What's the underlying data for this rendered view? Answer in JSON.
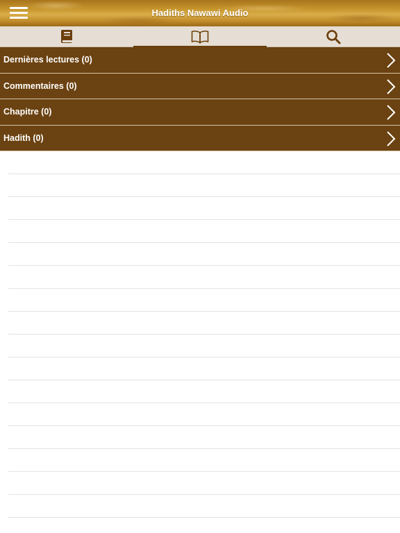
{
  "header": {
    "title": "Hadiths Nawawi Audio",
    "menu_icon": "hamburger-menu-icon"
  },
  "tabs": [
    {
      "icon": "book-icon",
      "active": false
    },
    {
      "icon": "open-book-icon",
      "active": true
    },
    {
      "icon": "search-icon",
      "active": false
    }
  ],
  "menu": {
    "items": [
      {
        "label": "Dernières lectures (0)"
      },
      {
        "label": "Commentaires (0)"
      },
      {
        "label": "Chapitre (0)"
      },
      {
        "label": "Hadith (0)"
      }
    ]
  },
  "colors": {
    "header_gold": "#c8962e",
    "row_brown": "#6b4211",
    "tab_background": "#e6ded4",
    "tab_indicator": "#6b3e0d"
  }
}
